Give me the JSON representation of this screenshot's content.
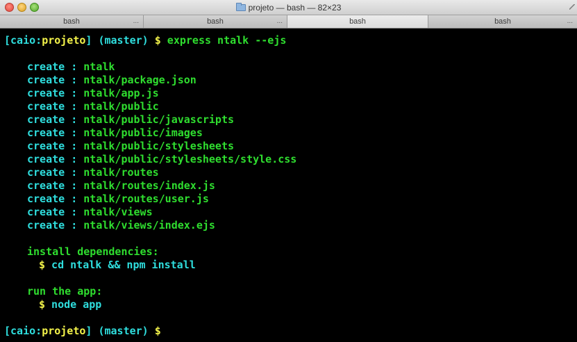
{
  "window": {
    "title": "projeto — bash — 82×23",
    "tabs": [
      {
        "label": "bash",
        "has_dots": true
      },
      {
        "label": "bash",
        "has_dots": true
      },
      {
        "label": "bash",
        "has_dots": false,
        "active": true
      },
      {
        "label": "bash",
        "has_dots": true
      }
    ]
  },
  "prompt": {
    "open": "[caio:",
    "dir": "projeto",
    "close": "]",
    "branch": " (master)",
    "symbol": " $"
  },
  "command": " express ntalk --ejs",
  "create_label": "create : ",
  "created_files": [
    "ntalk",
    "ntalk/package.json",
    "ntalk/app.js",
    "ntalk/public",
    "ntalk/public/javascripts",
    "ntalk/public/images",
    "ntalk/public/stylesheets",
    "ntalk/public/stylesheets/style.css",
    "ntalk/routes",
    "ntalk/routes/index.js",
    "ntalk/routes/user.js",
    "ntalk/views",
    "ntalk/views/index.ejs"
  ],
  "install": {
    "heading": "install dependencies:",
    "cmd_prefix": "$",
    "cmd": " cd ntalk && npm install"
  },
  "run": {
    "heading": "run the app:",
    "cmd_prefix": "$",
    "cmd": " node app"
  },
  "colors": {
    "green": "#2fde2f",
    "cyan": "#2fdede",
    "yellow": "#f3f34a",
    "background": "#000000"
  }
}
